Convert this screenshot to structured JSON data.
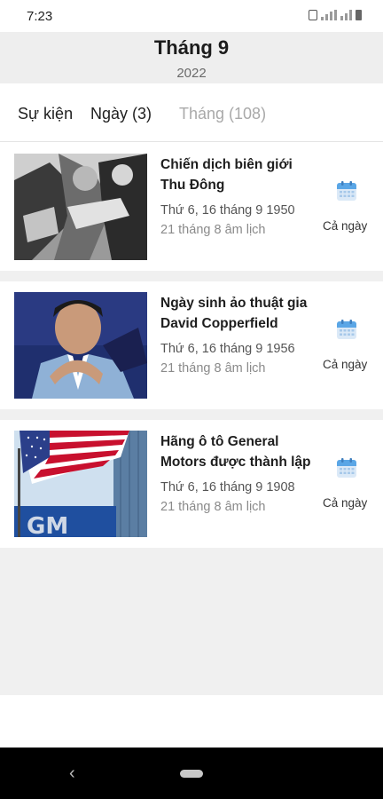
{
  "status": {
    "time": "7:23"
  },
  "header": {
    "title": "Tháng 9",
    "year": "2022"
  },
  "tabs": [
    {
      "label": "Sự kiện"
    },
    {
      "label": "Ngày (3)"
    },
    {
      "label": "Tháng (108)"
    }
  ],
  "events": [
    {
      "title": "Chiến dịch biên giới Thu Đông",
      "date": "Thứ 6, 16 tháng 9 1950",
      "lunar": "21 tháng 8 âm lịch",
      "allday": "Cả ngày",
      "image": "soldiers-photo"
    },
    {
      "title": "Ngày sinh ảo thuật gia David Copperfield",
      "date": "Thứ 6, 16 tháng 9 1956",
      "lunar": "21 tháng 8 âm lịch",
      "allday": "Cả ngày",
      "image": "portrait-photo"
    },
    {
      "title": "Hãng ô tô General Motors được thành lập",
      "date": "Thứ 6, 16 tháng 9 1908",
      "lunar": "21 tháng 8 âm lịch",
      "allday": "Cả ngày",
      "image": "gm-flag-photo"
    }
  ],
  "icons": {
    "calendar": "calendar-icon",
    "back": "back-icon",
    "home": "home-pill-icon"
  },
  "colors": {
    "calendar_blue": "#5aa6e6",
    "header_bg": "#eeeeee",
    "list_bg": "#f0f0f0",
    "inactive_tab": "#a9a9a9"
  },
  "thumb_logo": "GM"
}
